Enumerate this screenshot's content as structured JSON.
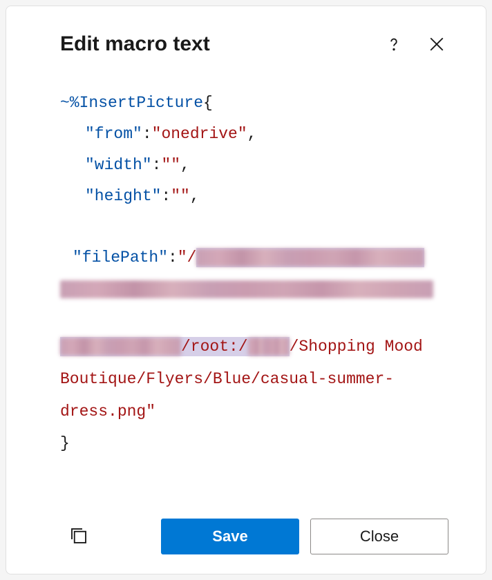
{
  "header": {
    "title": "Edit macro text"
  },
  "macro": {
    "prefix": "~%",
    "name": "InsertPicture",
    "openBrace": "{",
    "closeBrace": "}",
    "keys": {
      "from": "\"from\"",
      "width": "\"width\"",
      "height": "\"height\"",
      "filePath": "\"filePath\""
    },
    "values": {
      "from": "\"onedrive\"",
      "width": "\"\"",
      "height": "\"\"",
      "filePathStart": "\"/",
      "filePathRoot": "/root:/",
      "filePathVisible": "/Shopping Mood Boutique/Flyers/Blue/casual-summer-dress.png\""
    },
    "colon": ":",
    "comma": ","
  },
  "footer": {
    "saveLabel": "Save",
    "closeLabel": "Close"
  }
}
